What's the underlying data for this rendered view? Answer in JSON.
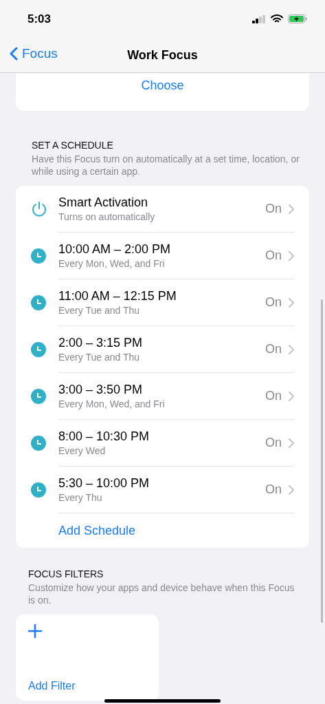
{
  "status_bar": {
    "time": "5:03"
  },
  "nav": {
    "back": "Focus",
    "title": "Work Focus"
  },
  "choose_card": {
    "action": "Choose"
  },
  "schedule": {
    "header": "SET A SCHEDULE",
    "description": "Have this Focus turn on automatically at a set time, location, or while using a certain app.",
    "rows": [
      {
        "kind": "smart",
        "title": "Smart Activation",
        "subtitle": "Turns on automatically",
        "value": "On"
      },
      {
        "kind": "time",
        "title": "10:00 AM – 2:00 PM",
        "subtitle": "Every Mon, Wed, and Fri",
        "value": "On"
      },
      {
        "kind": "time",
        "title": "11:00 AM – 12:15 PM",
        "subtitle": "Every Tue and Thu",
        "value": "On"
      },
      {
        "kind": "time",
        "title": "2:00 – 3:15 PM",
        "subtitle": "Every Tue and Thu",
        "value": "On"
      },
      {
        "kind": "time",
        "title": "3:00 – 3:50 PM",
        "subtitle": "Every Mon, Wed, and Fri",
        "value": "On"
      },
      {
        "kind": "time",
        "title": "8:00 – 10:30 PM",
        "subtitle": "Every Wed",
        "value": "On"
      },
      {
        "kind": "time",
        "title": "5:30 – 10:00 PM",
        "subtitle": "Every Thu",
        "value": "On"
      }
    ],
    "add": "Add Schedule"
  },
  "filters": {
    "header": "FOCUS FILTERS",
    "description": "Customize how your apps and device behave when this Focus is on.",
    "add": "Add Filter"
  }
}
